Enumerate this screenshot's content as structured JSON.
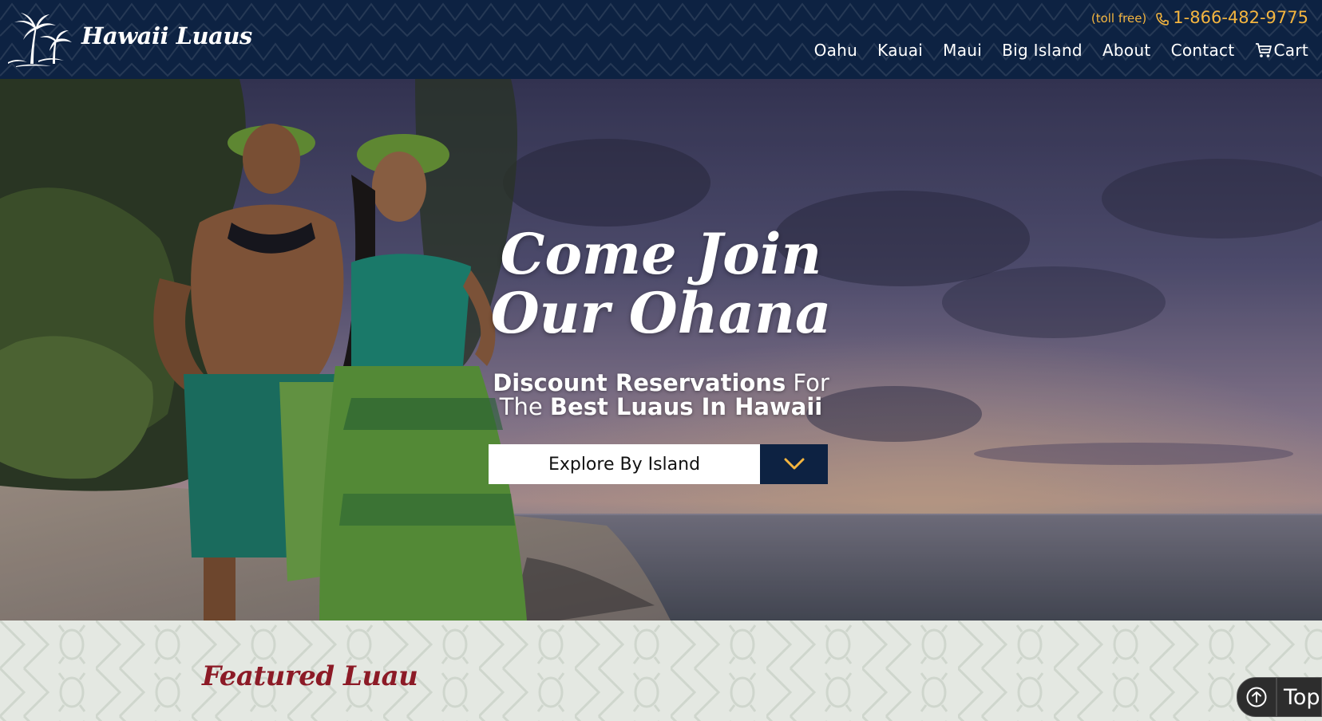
{
  "header": {
    "brand": "Hawaii Luaus",
    "toll_free": "(toll free)",
    "phone": "1-866-482-9775",
    "nav": [
      {
        "label": "Oahu"
      },
      {
        "label": "Kauai"
      },
      {
        "label": "Maui"
      },
      {
        "label": "Big Island"
      },
      {
        "label": "About"
      },
      {
        "label": "Contact"
      }
    ],
    "cart_label": "Cart"
  },
  "hero": {
    "title_line1": "Come Join",
    "title_line2": "Our Ohana",
    "sub_bold_1": "Discount Reservations",
    "sub_plain_1": " For",
    "sub_plain_2": "The ",
    "sub_bold_2": "Best Luaus In Hawaii",
    "explore_label": "Explore By Island"
  },
  "featured": {
    "title": "Featured Luau"
  },
  "back_to_top": {
    "label": "Top"
  },
  "colors": {
    "header_bg": "#0d2242",
    "phone_accent": "#f4b53f",
    "featured_title": "#8c1a26",
    "section_bg": "#e4e8e2"
  },
  "icons": {
    "logo": "palm-trees-icon",
    "phone": "phone-icon",
    "cart": "cart-icon",
    "dropdown": "chevron-down-icon",
    "top": "arrow-up-circle-icon"
  }
}
